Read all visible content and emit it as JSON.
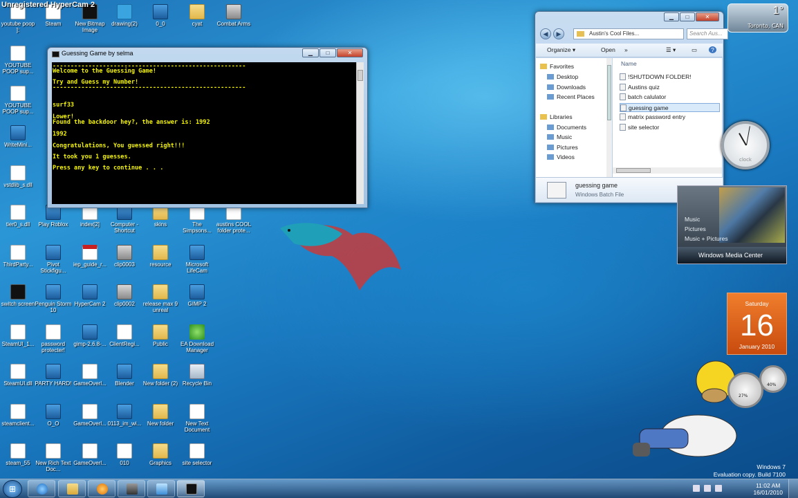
{
  "watermark": "Unregistered HyperCam 2",
  "desktop_icons": [
    {
      "label": "youtube poop ]:",
      "icon": "youtube-poop-doc-icon"
    },
    {
      "label": "Steam",
      "icon": "steam-icon"
    },
    {
      "label": "New Bitmap Image",
      "icon": "bitmap-icon"
    },
    {
      "label": "drawing(2)",
      "icon": "drawing-icon"
    },
    {
      "label": "0_0",
      "icon": "app-icon"
    },
    {
      "label": "cyat",
      "icon": "folder-icon"
    },
    {
      "label": "Combat Arms",
      "icon": "combat-arms-icon"
    },
    {
      "label": "YOUTUBE POOP sup...",
      "icon": "youtube-poop-doc-icon"
    },
    {
      "label": "YOUTUBE POOP sup...",
      "icon": "youtube-poop-doc-icon"
    },
    {
      "label": "WriteMini...",
      "icon": "app-icon"
    },
    {
      "label": "vstdlib_s.dll",
      "icon": "dll-icon"
    },
    {
      "label": "tier0_s.dll",
      "icon": "dll-icon"
    },
    {
      "label": "Play Roblox",
      "icon": "roblox-icon"
    },
    {
      "label": "index[2]",
      "icon": "document-icon"
    },
    {
      "label": "Computer - Shortcut",
      "icon": "computer-icon"
    },
    {
      "label": "skins",
      "icon": "folder-icon"
    },
    {
      "label": "The Simpsons...",
      "icon": "document-icon"
    },
    {
      "label": "austins COOL folder prote...",
      "icon": "document-icon"
    },
    {
      "label": "ThirdParty...",
      "icon": "document-icon"
    },
    {
      "label": "Pivot Stickfigu...",
      "icon": "pivot-icon"
    },
    {
      "label": "iep_guide_r...",
      "icon": "pdf-icon"
    },
    {
      "label": "clip0003",
      "icon": "clip-icon"
    },
    {
      "label": "resource",
      "icon": "folder-icon"
    },
    {
      "label": "Microsoft LifeCam",
      "icon": "lifecam-icon"
    },
    {
      "label": "switch screen",
      "icon": "switch-screen-icon"
    },
    {
      "label": "Penguin Storm 10",
      "icon": "penguin-icon"
    },
    {
      "label": "HyperCam 2",
      "icon": "hypercam-icon"
    },
    {
      "label": "clip0002",
      "icon": "clip-icon"
    },
    {
      "label": "release max 9 unreal",
      "icon": "folder-icon"
    },
    {
      "label": "GIMP 2",
      "icon": "gimp-icon"
    },
    {
      "label": "SteamUI_1...",
      "icon": "steam-icon"
    },
    {
      "label": "password protecter!",
      "icon": "document-icon"
    },
    {
      "label": "gimp-2.6.8-...",
      "icon": "installer-icon"
    },
    {
      "label": "ClientRegi...",
      "icon": "document-icon"
    },
    {
      "label": "Public",
      "icon": "folder-icon"
    },
    {
      "label": "EA Download Manager",
      "icon": "ea-icon"
    },
    {
      "label": "SteamUI.dll",
      "icon": "dll-icon"
    },
    {
      "label": "PARTY HARD!",
      "icon": "party-icon"
    },
    {
      "label": "GameOverl...",
      "icon": "document-icon"
    },
    {
      "label": "Blender",
      "icon": "blender-icon"
    },
    {
      "label": "New folder (2)",
      "icon": "folder-icon"
    },
    {
      "label": "Recycle Bin",
      "icon": "recycle-bin-icon"
    },
    {
      "label": "steamclient...",
      "icon": "dll-icon"
    },
    {
      "label": "O_O",
      "icon": "app-icon"
    },
    {
      "label": "GameOverl...",
      "icon": "document-icon"
    },
    {
      "label": "0113_im_wi...",
      "icon": "image-icon"
    },
    {
      "label": "New folder",
      "icon": "folder-icon"
    },
    {
      "label": "New Text Document",
      "icon": "text-doc-icon"
    },
    {
      "label": "steam_55",
      "icon": "steam-icon"
    },
    {
      "label": "New Rich Text Doc...",
      "icon": "document-icon"
    },
    {
      "label": "GameOverl...",
      "icon": "dll-icon"
    },
    {
      "label": "010",
      "icon": "document-icon"
    },
    {
      "label": "Graphics",
      "icon": "folder-icon"
    },
    {
      "label": "site selector",
      "icon": "text-doc-icon"
    }
  ],
  "console": {
    "title": "Guessing Game by selma",
    "minimize": "▁",
    "maximize": "□",
    "close": "✕",
    "lines": [
      "------------------------------------------------------",
      "Welcome to the Guessing Game!",
      "Try and Guess my Number!",
      "------------------------------------------------------",
      "surf33",
      "Lower!",
      "Found the backdoor hey?, the answer is: 1992",
      "1992",
      "Congratulations, You guessed right!!!",
      "It took you 1 guesses.",
      "Press any key to continue . . ."
    ]
  },
  "explorer": {
    "address": "Austin's Cool Files...",
    "search_placeholder": "Search Aus...",
    "toolbar": {
      "organize": "Organize ▾",
      "open": "Open",
      "more": "»"
    },
    "nav": {
      "favorites": "Favorites",
      "items1": [
        "Desktop",
        "Downloads",
        "Recent Places"
      ],
      "libraries": "Libraries",
      "items2": [
        "Documents",
        "Music",
        "Pictures",
        "Videos"
      ]
    },
    "column_name": "Name",
    "files": [
      "!SHUTDOWN FOLDER!",
      "Austins quiz",
      "batch calulator",
      "guessing game",
      "matrix password entry",
      "site selector"
    ],
    "selected_index": 3,
    "details": {
      "name": "guessing game",
      "type": "Windows Batch File"
    }
  },
  "weather": {
    "temp": "1°",
    "city": "Toronto, CAN"
  },
  "clock": {
    "label": "clock"
  },
  "media_center": {
    "items": [
      "Music",
      "Pictures",
      "Music + Pictures"
    ],
    "title": "Windows Media Center"
  },
  "calendar": {
    "day": "Saturday",
    "date": "16",
    "month_year": "January 2010"
  },
  "meter": {
    "cpu": "27%",
    "mem": "40%"
  },
  "windows_mark": {
    "line1": "Windows 7",
    "line2": "Evaluation copy. Build 7100"
  },
  "taskbar": {
    "start": "⊞",
    "time": "11:02 AM",
    "date": "16/01/2010"
  }
}
